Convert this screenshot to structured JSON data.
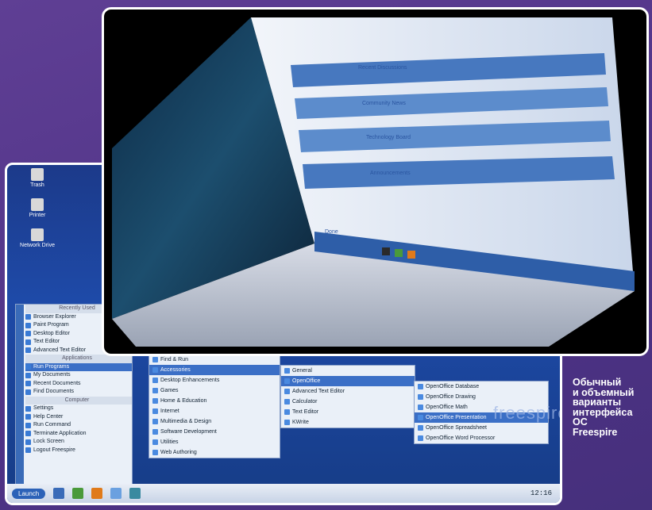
{
  "flat_desktop": {
    "desktop_icons": [
      {
        "label": "Trash",
        "icon": "trash-icon"
      },
      {
        "label": "Printer",
        "icon": "printer-icon"
      },
      {
        "label": "Network Drive",
        "icon": "network-icon"
      }
    ],
    "kmenu": {
      "items": [
        {
          "label": "Recently Used",
          "type": "header"
        },
        {
          "label": "Browser Explorer",
          "type": "item"
        },
        {
          "label": "Paint Program",
          "type": "item"
        },
        {
          "label": "Desktop Editor",
          "type": "item"
        },
        {
          "label": "Text Editor",
          "type": "item"
        },
        {
          "label": "Advanced Text Editor",
          "type": "item"
        },
        {
          "label": "Applications",
          "type": "header"
        },
        {
          "label": "Run Programs",
          "type": "selected"
        },
        {
          "label": "My Documents",
          "type": "item"
        },
        {
          "label": "Recent Documents",
          "type": "item"
        },
        {
          "label": "Find Documents",
          "type": "item"
        },
        {
          "label": "Computer",
          "type": "header"
        },
        {
          "label": "Settings",
          "type": "item"
        },
        {
          "label": "Help Center",
          "type": "item"
        },
        {
          "label": "Run Command",
          "type": "item"
        },
        {
          "label": "Terminate Application",
          "type": "item"
        },
        {
          "label": "Lock Screen",
          "type": "item"
        },
        {
          "label": "Logout Freespire",
          "type": "item"
        }
      ]
    },
    "submenu1": [
      "Find & Run",
      "Accessories",
      "Desktop Enhancements",
      "Games",
      "Home & Education",
      "Internet",
      "Multimedia & Design",
      "Software Development",
      "Utilities",
      "Web Authoring"
    ],
    "submenu2": [
      "General",
      "OpenOffice",
      "Advanced Text Editor",
      "Calculator",
      "Text Editor",
      "KWrite"
    ],
    "submenu3": [
      "OpenOffice Database",
      "OpenOffice Drawing",
      "OpenOffice Math",
      "OpenOffice Presentation",
      "OpenOffice Spreadsheet",
      "OpenOffice Word Processor"
    ],
    "brand_text": "freespire",
    "taskbar": {
      "start_label": "Launch",
      "clock": "12:16"
    }
  },
  "cube_view": {
    "window_rows": [
      "Recent Discussions",
      "Community News",
      "Technology Board",
      "Announcements"
    ],
    "status_text": "Done"
  },
  "caption": {
    "lines": [
      "Обычный",
      "и объемный",
      "варианты",
      "интерфейса",
      "ОС",
      "Freespire"
    ]
  },
  "colors": {
    "background": "#5a3d8f",
    "accent": "#3b6fc6",
    "caption_text": "#ffffff"
  }
}
